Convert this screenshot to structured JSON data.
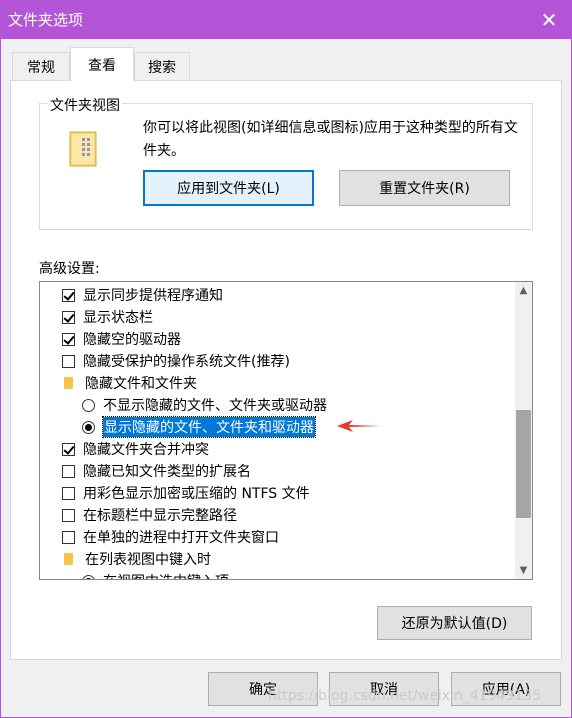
{
  "window": {
    "title": "文件夹选项",
    "close_icon": "close-icon"
  },
  "tabs": [
    {
      "label": "常规"
    },
    {
      "label": "查看"
    },
    {
      "label": "搜索"
    }
  ],
  "folder_views": {
    "group_label": "文件夹视图",
    "description": "你可以将此视图(如详细信息或图标)应用于这种类型的所有文件夹。",
    "apply_button": "应用到文件夹(L)",
    "reset_button": "重置文件夹(R)"
  },
  "advanced": {
    "label": "高级设置:",
    "items": [
      {
        "type": "checkbox",
        "checked": true,
        "label": "显示同步提供程序通知"
      },
      {
        "type": "checkbox",
        "checked": true,
        "label": "显示状态栏"
      },
      {
        "type": "checkbox",
        "checked": true,
        "label": "隐藏空的驱动器"
      },
      {
        "type": "checkbox",
        "checked": false,
        "label": "隐藏受保护的操作系统文件(推荐)"
      },
      {
        "type": "folder",
        "label": "隐藏文件和文件夹"
      },
      {
        "type": "radio",
        "checked": false,
        "label": "不显示隐藏的文件、文件夹或驱动器"
      },
      {
        "type": "radio",
        "checked": true,
        "label": "显示隐藏的文件、文件夹和驱动器",
        "selected": true
      },
      {
        "type": "checkbox",
        "checked": true,
        "label": "隐藏文件夹合并冲突"
      },
      {
        "type": "checkbox",
        "checked": false,
        "label": "隐藏已知文件类型的扩展名"
      },
      {
        "type": "checkbox",
        "checked": false,
        "label": "用彩色显示加密或压缩的 NTFS 文件"
      },
      {
        "type": "checkbox",
        "checked": false,
        "label": "在标题栏中显示完整路径"
      },
      {
        "type": "checkbox",
        "checked": false,
        "label": "在单独的进程中打开文件夹窗口"
      },
      {
        "type": "folder",
        "label": "在列表视图中键入时"
      },
      {
        "type": "radio",
        "checked": true,
        "label": "在视图中选中键入项"
      }
    ],
    "restore_button": "还原为默认值(D)"
  },
  "footer": {
    "ok": "确定",
    "cancel": "取消",
    "apply": "应用(A)"
  },
  "watermark": "https://blog.csdn.net/weixin_41949135",
  "colors": {
    "titlebar": "#b455d8",
    "accent": "#0078d7",
    "annotation": "#e53935"
  }
}
